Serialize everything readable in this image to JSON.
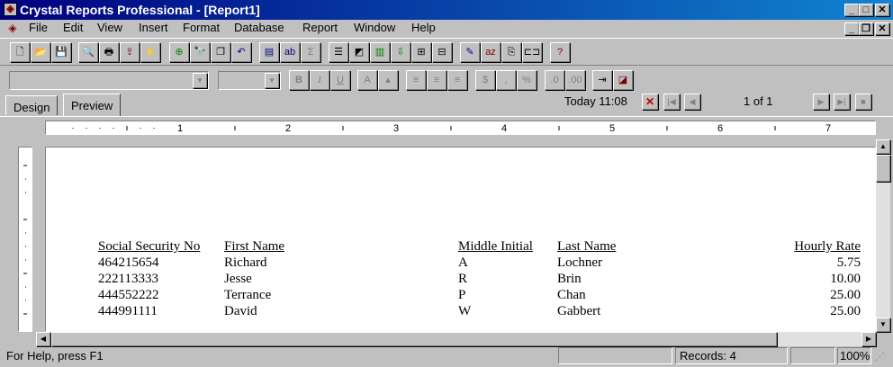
{
  "window": {
    "title": "Crystal Reports Professional - [Report1]"
  },
  "menu": [
    "File",
    "Edit",
    "View",
    "Insert",
    "Format",
    "Database",
    "Report",
    "Window",
    "Help"
  ],
  "tabs": [
    "Design",
    "Preview"
  ],
  "nav": {
    "today": "Today 11:08",
    "page": "1 of 1"
  },
  "ruler": [
    "1",
    "2",
    "3",
    "4",
    "5",
    "6",
    "7"
  ],
  "format_toolbar": {
    "bold": "B",
    "italic": "I",
    "underline": "U",
    "currency": "$",
    "comma": ",",
    "percent": "%"
  },
  "report": {
    "columns": [
      "Social Security No",
      "First Name",
      "Middle Initial",
      "Last Name",
      "Hourly Rate"
    ],
    "rows": [
      [
        "464215654",
        "Richard",
        "A",
        "Lochner",
        "5.75"
      ],
      [
        "222113333",
        "Jesse",
        "R",
        "Brin",
        "10.00"
      ],
      [
        "444552222",
        "Terrance",
        "P",
        "Chan",
        "25.00"
      ],
      [
        "444991111",
        "David",
        "W",
        "Gabbert",
        "25.00"
      ]
    ]
  },
  "status": {
    "help": "For Help, press F1",
    "records": "Records: 4",
    "zoom": "100%"
  }
}
